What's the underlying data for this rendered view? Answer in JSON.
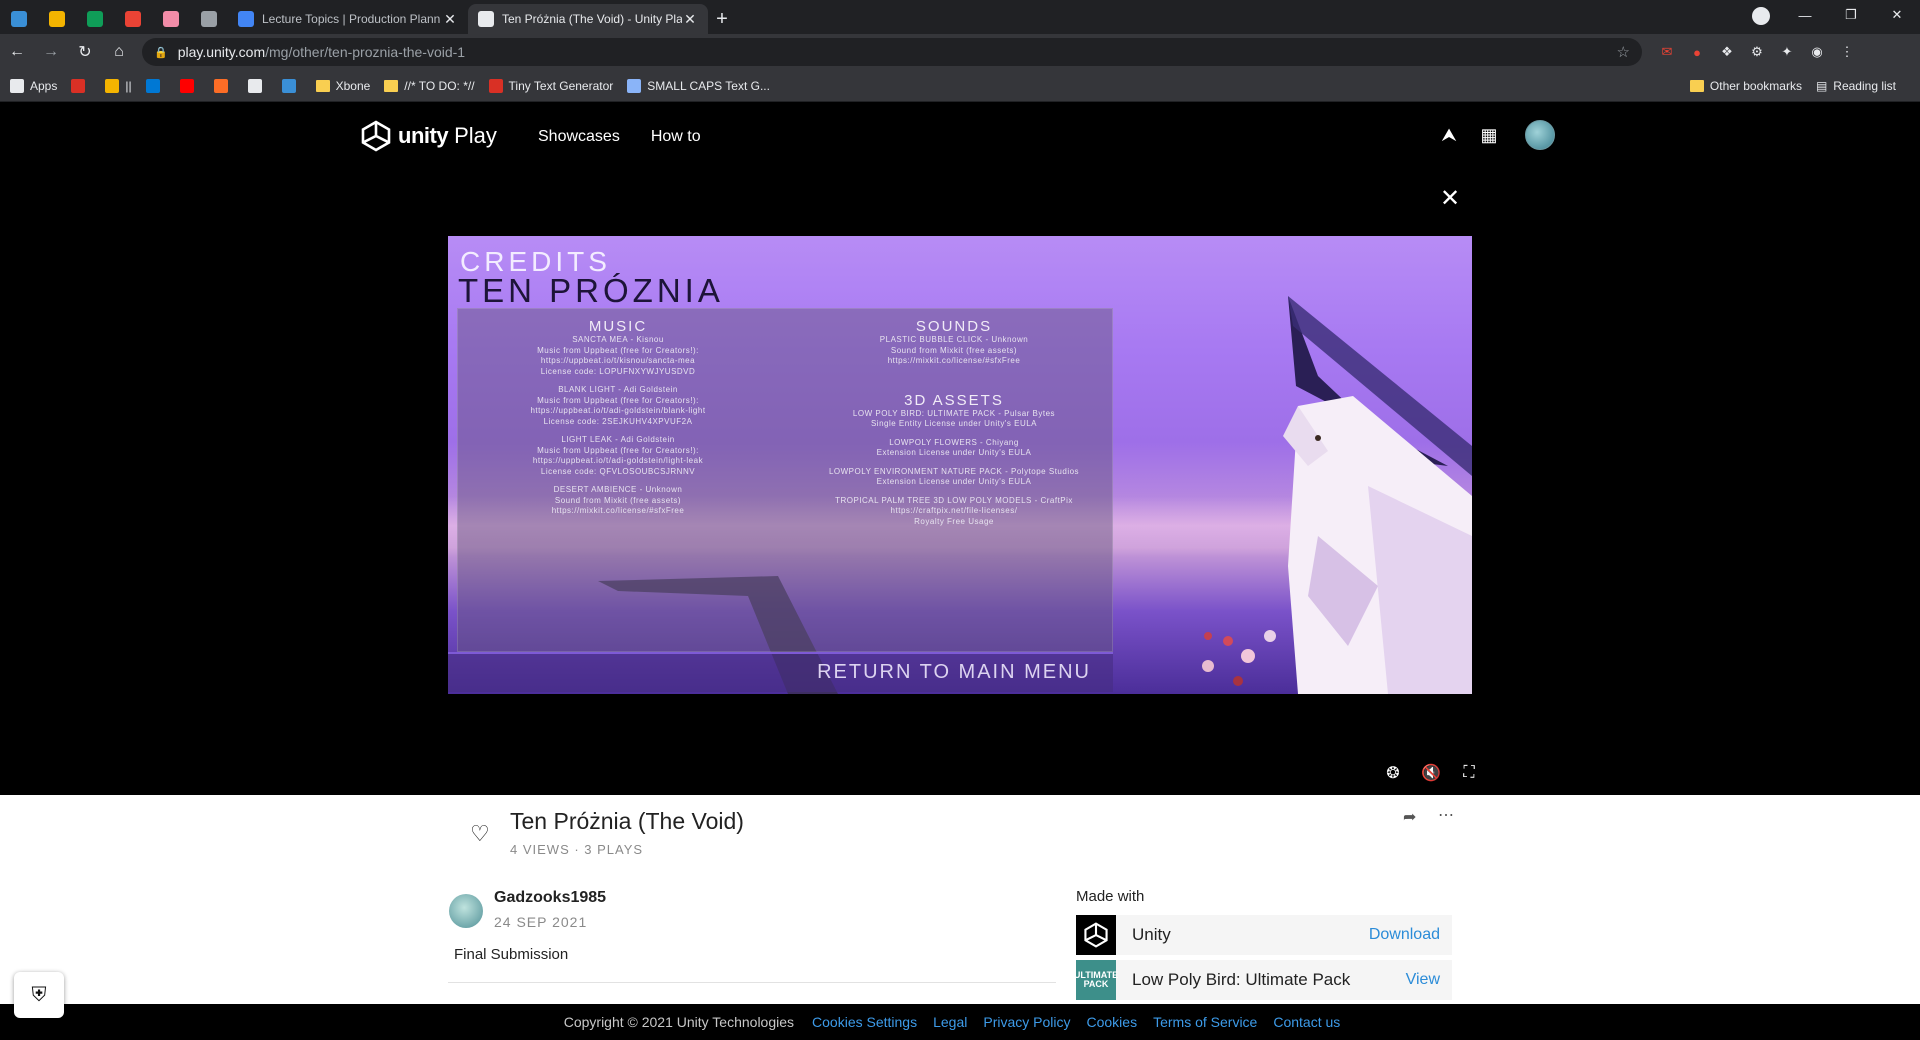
{
  "browser": {
    "pinned_tabs": [
      {
        "icon": "edge-icon",
        "color": "#3a8fd6"
      },
      {
        "icon": "drive-icon",
        "color": "#f4b400"
      },
      {
        "icon": "drive-icon",
        "color": "#0f9d58"
      },
      {
        "icon": "gmail-icon",
        "color": "#ea4335"
      },
      {
        "icon": "app-icon",
        "color": "#f28ca8"
      },
      {
        "icon": "globe-icon",
        "color": "#9aa0a6"
      }
    ],
    "tabs": [
      {
        "title": "Lecture Topics | Production Plann",
        "icon": "docs-icon",
        "color": "#4285f4",
        "active": false
      },
      {
        "title": "Ten Próżnia (The Void) - Unity Pla",
        "icon": "unity-icon",
        "color": "#e8eaed",
        "active": true
      }
    ],
    "address": {
      "host": "play.unity.com",
      "path": "/mg/other/ten-proznia-the-void-1"
    },
    "bookmarks": [
      {
        "label": "Apps",
        "icon": "apps-grid-icon",
        "color": "#e8eaed"
      },
      {
        "label": "",
        "icon": "calendar-icon",
        "color": "#d93025"
      },
      {
        "label": "||",
        "icon": "drive-icon",
        "color": "#f4b400"
      },
      {
        "label": "",
        "icon": "outlook-icon",
        "color": "#0078d4"
      },
      {
        "label": "",
        "icon": "youtube-icon",
        "color": "#ff0000"
      },
      {
        "label": "",
        "icon": "gitlab-icon",
        "color": "#fc6d26"
      },
      {
        "label": "",
        "icon": "github-icon",
        "color": "#e8eaed"
      },
      {
        "label": "",
        "icon": "edge-icon",
        "color": "#3a8fd6"
      },
      {
        "label": "Xbone",
        "icon": "folder-icon",
        "color": "#f9cf51"
      },
      {
        "label": "//* TO DO: *//",
        "icon": "folder-icon",
        "color": "#f9cf51"
      },
      {
        "label": "Tiny Text Generator",
        "icon": "generator-icon",
        "color": "#d93025"
      },
      {
        "label": "SMALL CAPS Text G...",
        "icon": "braces-icon",
        "color": "#8ab4f8"
      }
    ],
    "bookmarks_right": {
      "other": "Other bookmarks",
      "reading": "Reading list"
    }
  },
  "site": {
    "logo_word1": "unity",
    "logo_word2": "Play",
    "nav": [
      "Showcases",
      "How to"
    ]
  },
  "game": {
    "credits_label": "CREDITS",
    "title": "TEN PRÓZNIA",
    "music_heading": "MUSIC",
    "music": [
      [
        "SANCTA MEA - Kisnou",
        "Music from Uppbeat (free for Creators!):",
        "https://uppbeat.io/t/kisnou/sancta-mea",
        "License code: LOPUFNXYWJYUSDVD"
      ],
      [
        "BLANK LIGHT - Adi Goldstein",
        "Music from Uppbeat (free for Creators!):",
        "https://uppbeat.io/t/adi-goldstein/blank-light",
        "License code: 2SEJKUHV4XPVUF2A"
      ],
      [
        "LIGHT LEAK - Adi Goldstein",
        "Music from Uppbeat (free for Creators!):",
        "https://uppbeat.io/t/adi-goldstein/light-leak",
        "License code: QFVLOSOUBCSJRNNV"
      ],
      [
        "DESERT AMBIENCE - Unknown",
        "Sound from Mixkit (free assets)",
        "https://mixkit.co/license/#sfxFree"
      ]
    ],
    "sounds_heading": "SOUNDS",
    "sounds": [
      [
        "PLASTIC BUBBLE CLICK - Unknown",
        "Sound from Mixkit (free assets)",
        "https://mixkit.co/license/#sfxFree"
      ]
    ],
    "assets_heading": "3D ASSETS",
    "assets": [
      [
        "LOW POLY BIRD: ULTIMATE PACK - Pulsar Bytes",
        "Single Entity License under Unity's EULA"
      ],
      [
        "LOWPOLY FLOWERS - Chiyang",
        "Extension License under Unity's EULA"
      ],
      [
        "LOWPOLY ENVIRONMENT NATURE PACK - Polytope Studios",
        "Extension License under Unity's EULA"
      ],
      [
        "TROPICAL PALM TREE 3D LOW POLY MODELS - CraftPix",
        "https://craftpix.net/file-licenses/",
        "Royalty Free Usage"
      ]
    ],
    "return_label": "RETURN TO MAIN MENU"
  },
  "project": {
    "title": "Ten Próżnia (The Void)",
    "stats": "4 VIEWS · 3 PLAYS",
    "author": "Gadzooks1985",
    "date": "24 SEP 2021",
    "description": "Final Submission",
    "made_with_label": "Made with",
    "made_with": [
      {
        "name": "Unity",
        "action": "Download",
        "thumb": "unity-logo",
        "thumb_color": "#000000"
      },
      {
        "name": "Low Poly Bird: Ultimate Pack",
        "action": "View",
        "thumb": "ULTIMATE PACK",
        "thumb_color": "#3d8f8a"
      }
    ]
  },
  "footer": {
    "copyright": "Copyright © 2021 Unity Technologies",
    "links": [
      "Cookies Settings",
      "Legal",
      "Privacy Policy",
      "Cookies",
      "Terms of Service",
      "Contact us"
    ]
  },
  "colors": {
    "link": "#2b8cd8",
    "footer_link": "#3d9be9",
    "chrome_bg": "#202124"
  }
}
